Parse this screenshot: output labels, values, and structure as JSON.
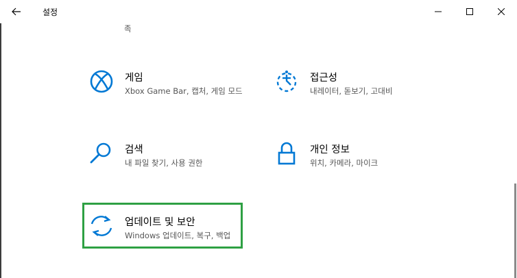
{
  "window": {
    "title": "설정",
    "colors": {
      "accent": "#0078d4",
      "highlight": "#2ea043"
    }
  },
  "partial_desc": "족",
  "tiles": [
    {
      "title": "게임",
      "desc": "Xbox Game Bar, 캡처, 게임 모드",
      "icon": "xbox-icon"
    },
    {
      "title": "접근성",
      "desc": "내레이터, 돋보기, 고대비",
      "icon": "ease-of-access-icon"
    },
    {
      "title": "검색",
      "desc": "내 파일 찾기, 사용 권한",
      "icon": "search-icon"
    },
    {
      "title": "개인 정보",
      "desc": "위치, 카메라, 마이크",
      "icon": "lock-icon"
    },
    {
      "title": "업데이트 및 보안",
      "desc": "Windows 업데이트, 복구, 백업",
      "icon": "sync-icon"
    }
  ]
}
